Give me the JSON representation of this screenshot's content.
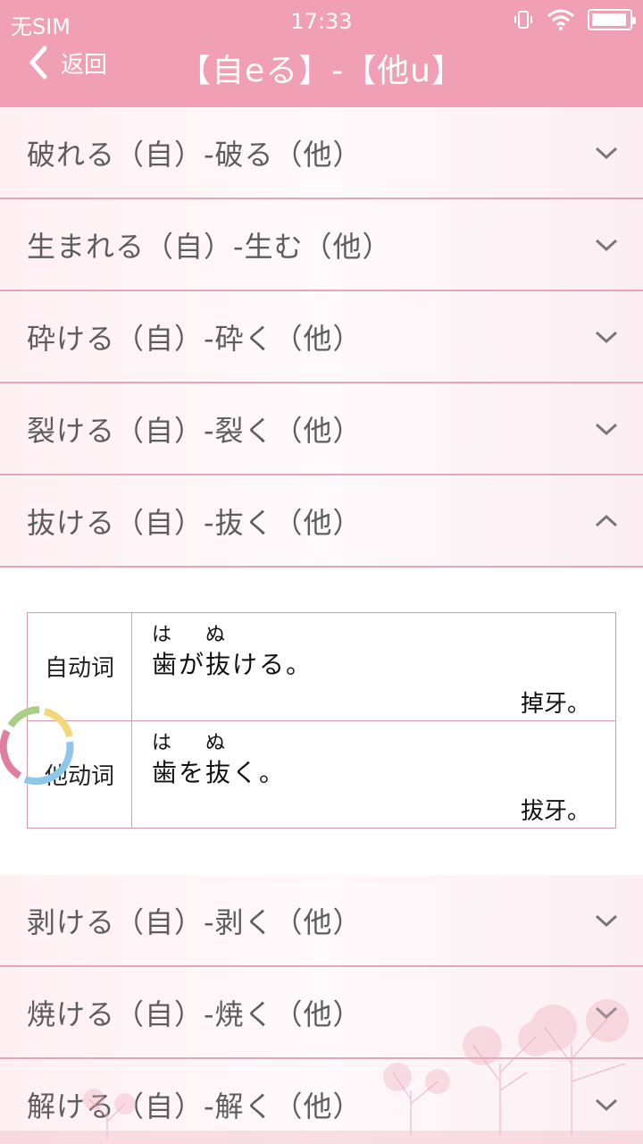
{
  "status_bar": {
    "carrier": "无SIM",
    "time": "17:33"
  },
  "nav": {
    "back_label": "返回",
    "title": "【自eる】-【他u】"
  },
  "collapsed_before": [
    {
      "label": "破れる（自）-破る（他）"
    },
    {
      "label": "生まれる（自）-生む（他）"
    },
    {
      "label": "砕ける（自）-砕く（他）"
    },
    {
      "label": "裂ける（自）-裂く（他）"
    }
  ],
  "expanded": {
    "label": "抜ける（自）-抜く（他）",
    "examples": [
      {
        "type": "自动词",
        "furigana": [
          "は",
          "ぬ"
        ],
        "sentence": "歯が抜ける。",
        "translation": "掉牙。"
      },
      {
        "type": "他动词",
        "furigana": [
          "は",
          "ぬ"
        ],
        "sentence": "歯を抜く。",
        "translation": "拔牙。"
      }
    ]
  },
  "collapsed_after": [
    {
      "label": "剥ける（自）-剥く（他）"
    },
    {
      "label": "焼ける（自）-焼く（他）"
    },
    {
      "label": "解ける（自）-解く（他）"
    }
  ],
  "colors": {
    "header": "#f09fb5",
    "divider": "#e4a7b8",
    "table_border": "#d99aac"
  }
}
